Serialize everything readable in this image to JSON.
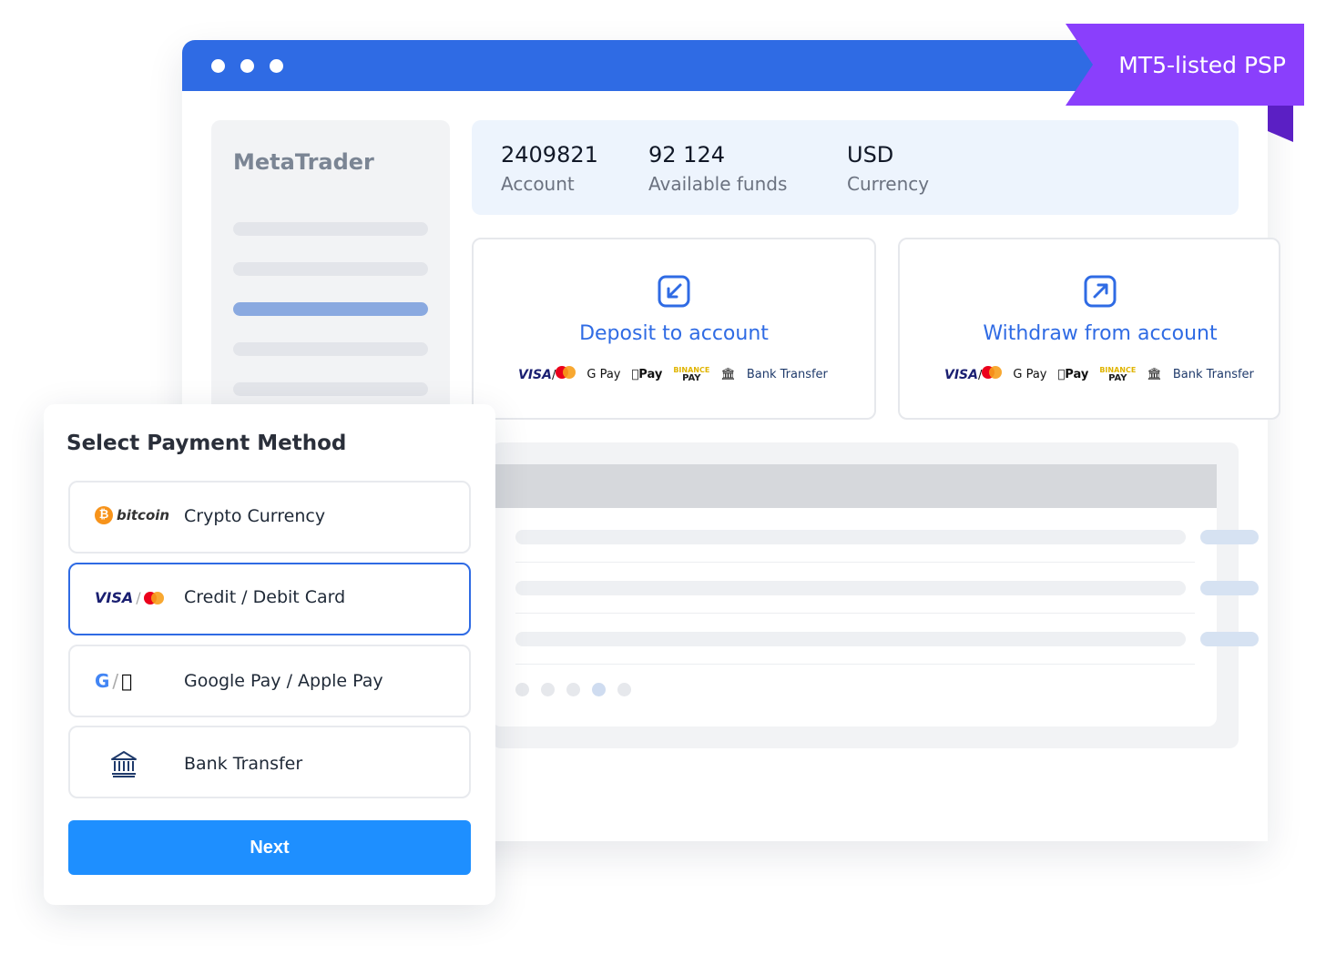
{
  "ribbon": {
    "label": "MT5-listed PSP"
  },
  "sidebar": {
    "title": "MetaTrader"
  },
  "account": {
    "number": "2409821",
    "number_label": "Account",
    "funds": "92 124",
    "funds_label": "Available funds",
    "currency": "USD",
    "currency_label": "Currency"
  },
  "deposit": {
    "title": "Deposit to account"
  },
  "withdraw": {
    "title": "Withdraw from account"
  },
  "methods_strip": {
    "visa": "VISA",
    "gpay": "G Pay",
    "applepay": "Pay",
    "binance_top": "BINANCE",
    "binance_bottom": "PAY",
    "bank": "Bank Transfer"
  },
  "modal": {
    "title": "Select Payment Method",
    "options": [
      {
        "label": "Crypto Currency",
        "logo": "bitcoin"
      },
      {
        "label": "Credit / Debit Card",
        "logo": "VISA"
      },
      {
        "label": "Google Pay / Apple Pay",
        "logo": "google-apple"
      },
      {
        "label": "Bank Transfer",
        "logo": "bank-icon"
      }
    ],
    "next": "Next"
  },
  "colors": {
    "brand_blue": "#2f6be4",
    "ribbon_purple": "#8a3ffc",
    "button_blue": "#1e8fff"
  }
}
